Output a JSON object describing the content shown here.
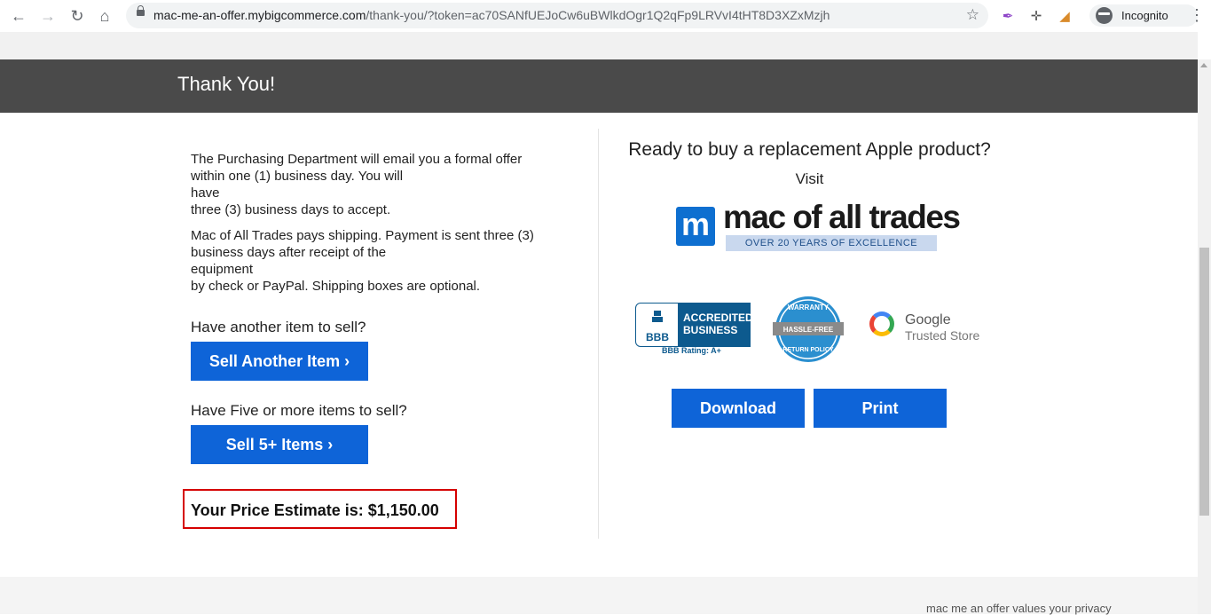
{
  "browser": {
    "url_host": "mac-me-an-offer.mybigcommerce.com",
    "url_path": "/thank-you/?token=ac70SANfUEJoCw6uBWlkdOgr1Q2qFp9LRVvI4tHT8D3XZxMzjh",
    "profile_label": "Incognito"
  },
  "header": {
    "title": "Thank You!"
  },
  "left": {
    "para1_line1": "The Purchasing Department will email you a formal offer",
    "para1_line2": "within one (1) business day. You will",
    "para1_line3": "have",
    "para1_line4": "three (3) business days to accept.",
    "para2_line1": "Mac of All Trades pays shipping. Payment is sent three (3)",
    "para2_line2": "business days after receipt of the",
    "para2_line3": "equipment",
    "para2_line4": "by check or PayPal. Shipping boxes are optional.",
    "another_question": "Have another item to sell?",
    "sell_another_label": "Sell Another Item ›",
    "five_question": "Have Five or more items to sell?",
    "sell_five_label": "Sell 5+ Items ›",
    "estimate_text": "Your Price Estimate is: $1,150.00"
  },
  "right": {
    "ready_text": "Ready to buy a replacement Apple product?",
    "visit_text": "Visit",
    "logo_letter": "m",
    "logo_text": "mac of all trades",
    "logo_tagline": "OVER 20 YEARS OF EXCELLENCE",
    "bbb_mark": "BBB",
    "bbb_line1": "ACCREDITED",
    "bbb_line2": "BUSINESS",
    "bbb_rating": "BBB Rating: A+",
    "warranty_top": "WARRANTY",
    "warranty_mid": "HASSLE-FREE",
    "warranty_bottom": "RETURN POLICY",
    "google_name": "Google",
    "google_sub": "Trusted Store",
    "download_label": "Download",
    "print_label": "Print"
  },
  "footer": {
    "privacy_text": "mac me an offer values your privacy"
  },
  "colors": {
    "accent": "#0e64d8",
    "header_bg": "#4a4a4a",
    "estimate_border": "#d50000"
  }
}
